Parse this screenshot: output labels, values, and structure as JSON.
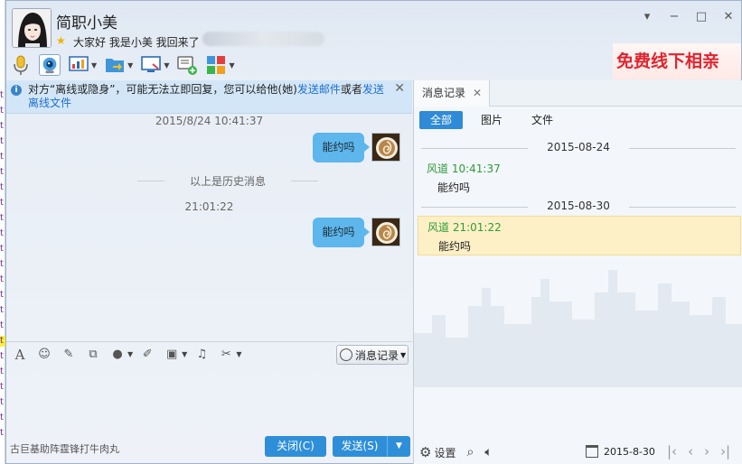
{
  "contact": {
    "name": "简职小美",
    "signature": "大家好 我是小美 我回来了"
  },
  "window_controls": [
    "▾",
    "−",
    "□",
    "✕"
  ],
  "ad": {
    "text": "免费线下相亲"
  },
  "notice": {
    "text_before": "对方“离线或隐身”，可能无法立即回复，您可以给他(她)",
    "link_email": "发送邮件",
    "middle": "或者",
    "link_file": "发送离线文件"
  },
  "chat": {
    "timestamp1": "2015/8/24 10:41:37",
    "message1": "能约吗",
    "history_divider": "以上是历史消息",
    "timestamp2": "21:01:22",
    "message2": "能约吗"
  },
  "input": {
    "history_button": "消息记录",
    "tip": "古巨基助阵霆锋打牛肉丸",
    "close_label": "关闭(C)",
    "send_label": "发送(S)"
  },
  "history_panel": {
    "tab_label": "消息记录",
    "filters": [
      "全部",
      "图片",
      "文件"
    ],
    "active_filter": "全部",
    "groups": [
      {
        "date": "2015-08-24",
        "sender": "风道 10:41:37",
        "text": "能约吗"
      },
      {
        "date": "2015-08-30",
        "sender": "风道 21:01:22",
        "text": "能约吗"
      }
    ],
    "settings_label": "设置",
    "current_date": "2015-8-30"
  },
  "colors": {
    "accent": "#2e8fd8",
    "bubble": "#5db6ec",
    "sender_green": "#2f9b3a",
    "highlight": "#fdf0c6",
    "ad_red": "#e0242f"
  }
}
